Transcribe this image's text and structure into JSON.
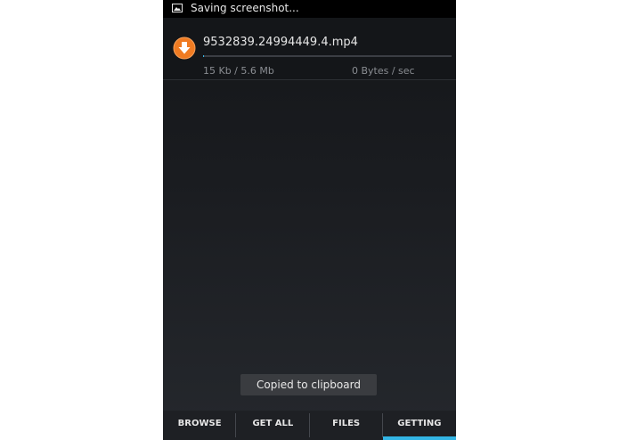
{
  "status_bar": {
    "text": "Saving screenshot...",
    "icon": "image-icon"
  },
  "download": {
    "icon": "download-icon",
    "file_name": "9532839.24994449.4.mp4",
    "progress_fraction": 0.003,
    "size": "15 Kb / 5.6 Mb",
    "speed": "0 Bytes / sec"
  },
  "toast": {
    "text": "Copied to clipboard"
  },
  "tabs": [
    {
      "label": "BROWSE",
      "active": false
    },
    {
      "label": "GET ALL",
      "active": false
    },
    {
      "label": "FILES",
      "active": false
    },
    {
      "label": "GETTING",
      "active": true
    }
  ],
  "colors": {
    "accent": "#33b5e5",
    "download_icon": "#f07b22",
    "background": "#141619",
    "status_bar": "#000000"
  }
}
